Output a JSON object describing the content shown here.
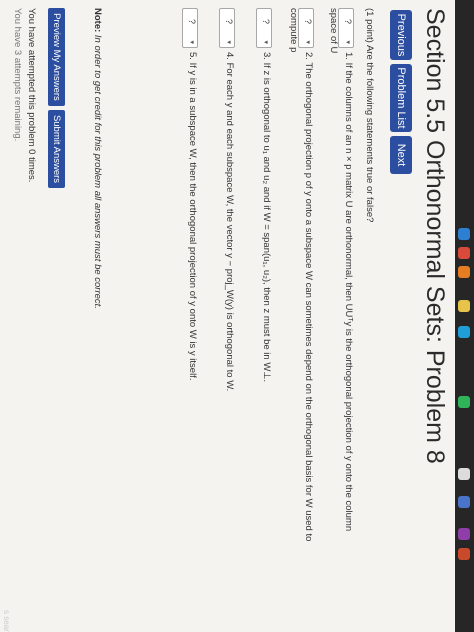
{
  "header": {
    "title": "Section 5.5 Orthonormal Sets: Problem 8"
  },
  "nav": {
    "previous": "Previous",
    "problem_list": "Problem List",
    "next": "Next"
  },
  "problem": {
    "prompt": "(1 point) Are the following statements true or false?",
    "questions": [
      {
        "number": "1.",
        "line1": "If the columns of an n × p matrix U are orthonormal, then UUᵀy is the orthogonal projection of y onto the column",
        "line2": "space of U"
      },
      {
        "number": "2.",
        "line1": "The orthogonal projection p of y onto a subspace W can sometimes depend on the orthogonal basis for W used to",
        "line2": "compute p"
      },
      {
        "number": "3.",
        "line1": "If z is orthogonal to u₁ and u₂ and if W = span(u₁, u₂), then z must be in W⊥.",
        "line2": ""
      },
      {
        "number": "4.",
        "line1": "For each y and each subspace W, the vector y − proj_W(y) is orthogonal to W.",
        "line2": ""
      },
      {
        "number": "5.",
        "line1": "If y is in a subspace W, then the orthogonal projection of y onto W is y itself.",
        "line2": ""
      }
    ],
    "select_value": "?",
    "select_arrow": "▾"
  },
  "note": {
    "label": "Note:",
    "text": "In order to get credit for this problem all answers must be correct."
  },
  "actions": {
    "preview": "Preview My Answers",
    "submit": "Submit Answers"
  },
  "attempts": {
    "line1": "You have attempted this problem 0 times.",
    "line2": "You have 3 attempts remaining."
  },
  "taskbar": {
    "search": "s search"
  },
  "colors": {
    "button": "#2c4ea0",
    "screen_bg": "#f4f3f0",
    "taskbar": "#262626"
  }
}
